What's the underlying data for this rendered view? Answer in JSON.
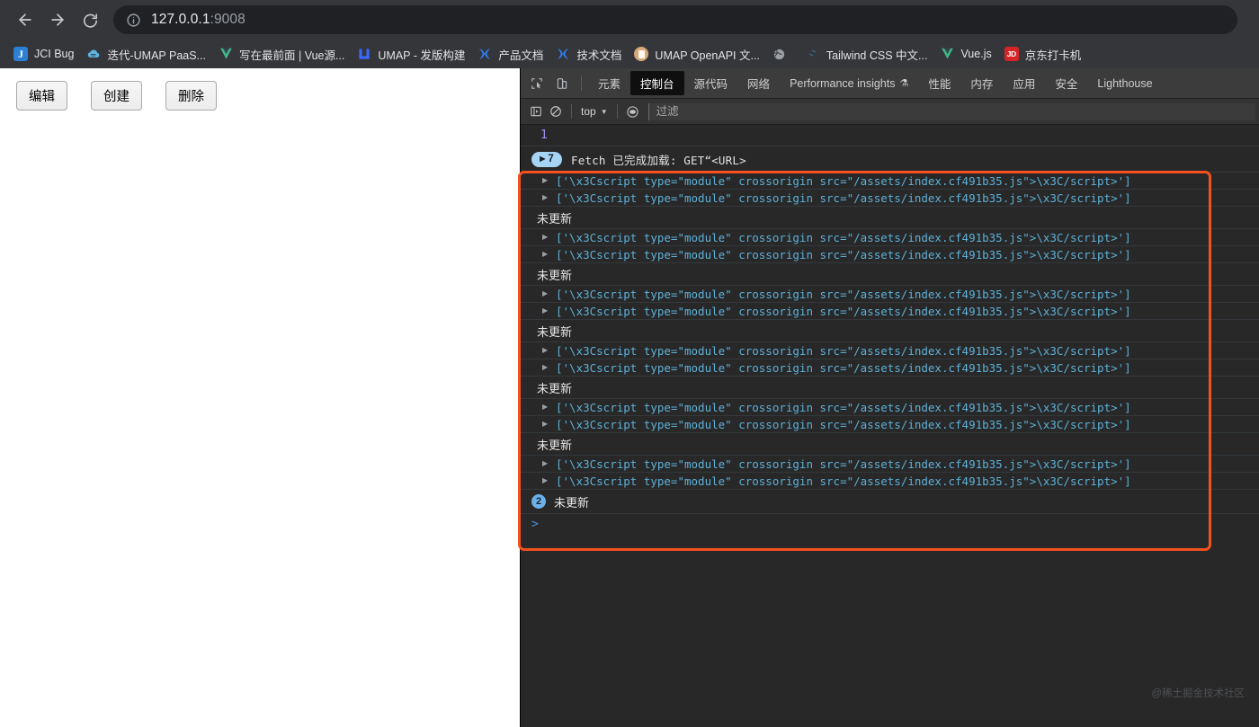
{
  "browser": {
    "nav": {
      "back_label": "back-arrow",
      "forward_label": "forward-arrow",
      "reload_label": "reload"
    },
    "omnibox": {
      "host": "127.0.0.1",
      "port": ":9008",
      "full_url": "127.0.0.1:9008"
    },
    "bookmarks": [
      {
        "label": "JCI Bug",
        "icon": "jci-favicon",
        "glyph": "J"
      },
      {
        "label": "迭代-UMAP PaaS...",
        "icon": "cloud-favicon",
        "glyph": "☁"
      },
      {
        "label": "写在最前面 | Vue源...",
        "icon": "vue-favicon",
        "glyph": "V"
      },
      {
        "label": "UMAP - 发版构建",
        "icon": "umap-favicon",
        "glyph": "ǃ"
      },
      {
        "label": "产品文档",
        "icon": "x-favicon",
        "glyph": "✖"
      },
      {
        "label": "技术文档",
        "icon": "x-favicon",
        "glyph": "✖"
      },
      {
        "label": "UMAP OpenAPI 文...",
        "icon": "document-favicon",
        "glyph": ""
      },
      {
        "label": "",
        "icon": "globe-favicon",
        "glyph": "ἱ0"
      },
      {
        "label": "Tailwind CSS 中文...",
        "icon": "tailwind-favicon",
        "glyph": "≈"
      },
      {
        "label": "Vue.js",
        "icon": "vue-favicon",
        "glyph": "V"
      },
      {
        "label": "京东打卡机",
        "icon": "jd-favicon",
        "glyph": "JD"
      }
    ]
  },
  "page": {
    "buttons": [
      {
        "label": "编辑",
        "name": "edit-button"
      },
      {
        "label": "创建",
        "name": "create-button"
      },
      {
        "label": "删除",
        "name": "delete-button"
      }
    ]
  },
  "devtools": {
    "tabs": [
      {
        "label": "元素",
        "active": false
      },
      {
        "label": "控制台",
        "active": true
      },
      {
        "label": "源代码",
        "active": false
      },
      {
        "label": "网络",
        "active": false
      },
      {
        "label": "Performance insights",
        "active": false,
        "badge": "⚗"
      },
      {
        "label": "性能",
        "active": false
      },
      {
        "label": "内存",
        "active": false
      },
      {
        "label": "应用",
        "active": false
      },
      {
        "label": "安全",
        "active": false
      },
      {
        "label": "Lighthouse",
        "active": false
      }
    ],
    "toolbar": {
      "sidebar_toggle": "console-sidebar-icon",
      "clear_console": "clear-console-icon",
      "context": "top",
      "caret": "▼",
      "eye": "live-expression-icon",
      "filter_placeholder": "过滤",
      "filter_value": ""
    },
    "console": {
      "count_marker": "1",
      "fetch_badge_count": "7",
      "fetch_badge_arrow": "▶",
      "fetch_message": "Fetch 已完成加载: GET“<URL>",
      "log_prefix": "['",
      "log_body": "\\x3Cscript type=\"module\" crossorigin src=\"/assets/index.cf491b35.js\">\\x3C/script>",
      "log_suffix": "']",
      "log_full": "['\\x3Cscript type=\"module\" crossorigin src=\"/assets/index.cf491b35.js\">\\x3C/script>']",
      "status_text": "未更新",
      "final_badge_count": "2",
      "final_status_text": "未更新",
      "prompt_caret": ">",
      "groups": [
        {
          "logs": 2,
          "status": "未更新"
        },
        {
          "logs": 2,
          "status": "未更新"
        },
        {
          "logs": 2,
          "status": "未更新"
        },
        {
          "logs": 2,
          "status": "未更新"
        },
        {
          "logs": 2,
          "status": "未更新"
        },
        {
          "logs": 2,
          "status": "未更新"
        }
      ]
    }
  },
  "annotation": {
    "type": "red-rectangle-highlight",
    "color": "#f4511e"
  },
  "watermark": "@稀土掘金技术社区"
}
